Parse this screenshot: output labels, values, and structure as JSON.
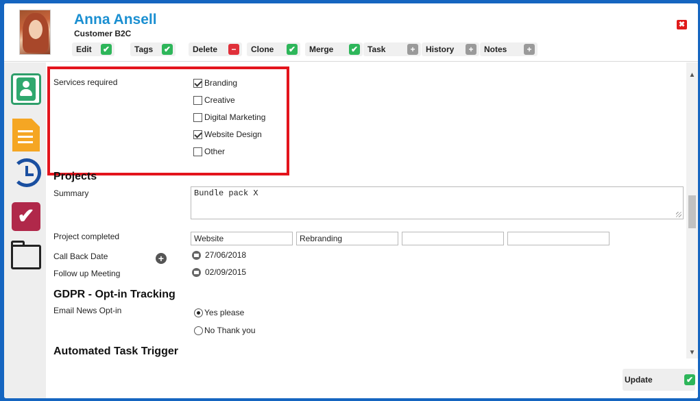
{
  "contact": {
    "name": "Anna Ansell",
    "type": "Customer B2C"
  },
  "actions": [
    {
      "label": "Edit",
      "icon": "check-icon"
    },
    {
      "label": "Tags",
      "icon": "check-icon"
    },
    {
      "label": "Delete",
      "icon": "minus-icon"
    },
    {
      "label": "Clone",
      "icon": "check-icon"
    },
    {
      "label": "Merge",
      "icon": "check-icon"
    },
    {
      "label": "Task",
      "icon": "plus-icon"
    },
    {
      "label": "History",
      "icon": "plus-icon"
    },
    {
      "label": "Notes",
      "icon": "plus-icon"
    }
  ],
  "icons": {
    "check": "✔",
    "minus": "−",
    "plus": "+",
    "close": "✖"
  },
  "services": {
    "label": "Services required",
    "options": [
      {
        "label": "Branding",
        "checked": true
      },
      {
        "label": "Creative",
        "checked": false
      },
      {
        "label": "Digital Marketing",
        "checked": false
      },
      {
        "label": "Website Design",
        "checked": true
      },
      {
        "label": "Other",
        "checked": false
      }
    ]
  },
  "projects": {
    "title": "Projects",
    "summary_label": "Summary",
    "summary_value": "Bundle pack X",
    "completed_label": "Project completed",
    "completed_values": [
      "Website",
      "Rebranding",
      "",
      ""
    ],
    "call_back_label": "Call Back Date",
    "call_back_value": "27/06/2018",
    "follow_up_label": "Follow up Meeting",
    "follow_up_value": "02/09/2015"
  },
  "gdpr": {
    "title": "GDPR - Opt-in Tracking",
    "email_label": "Email News Opt-in",
    "options": [
      {
        "label": "Yes please",
        "selected": true
      },
      {
        "label": "No Thank you",
        "selected": false
      }
    ]
  },
  "automated": {
    "title": "Automated Task Trigger"
  },
  "footer": {
    "update_label": "Update"
  },
  "colors": {
    "accent": "#1a8fd1",
    "highlight": "#e3141c",
    "check_green": "#2eb65a",
    "delete_red": "#e0303a"
  }
}
